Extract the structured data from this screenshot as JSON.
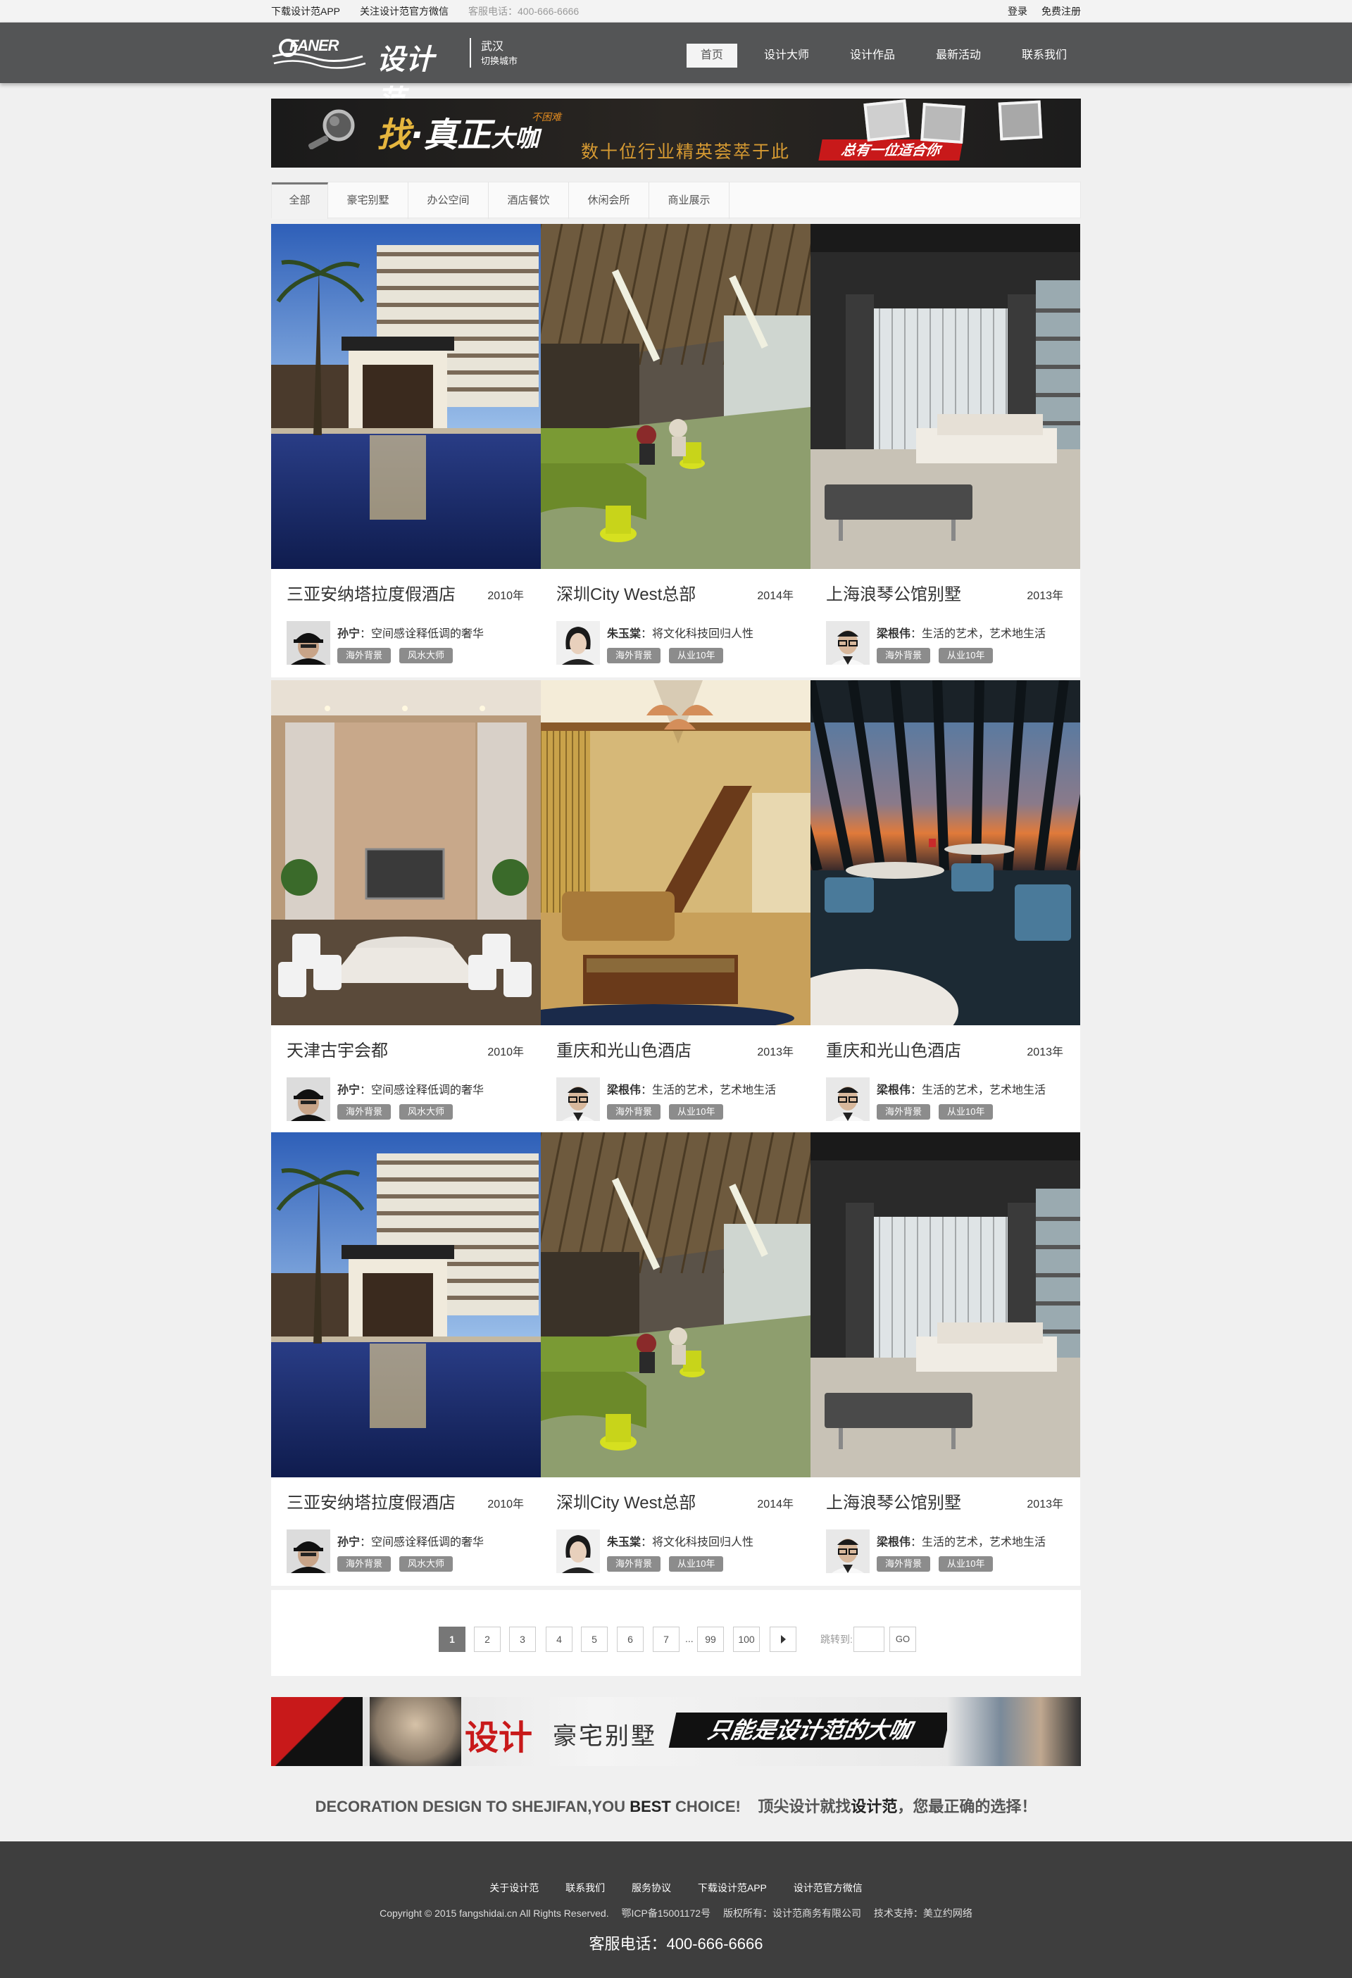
{
  "topbar": {
    "download_app": "下载设计范APP",
    "follow_wechat": "关注设计范官方微信",
    "phone": "客服电话：400-666-6666",
    "login": "登录",
    "register": "免费注册"
  },
  "header": {
    "logo_en": "FANER",
    "logo_cn": "设计范",
    "city": "武汉",
    "switch_city": "切换城市",
    "nav": [
      "首页",
      "设计大师",
      "设计作品",
      "最新活动",
      "联系我们"
    ]
  },
  "banner_top": {
    "find": "找",
    "dot": "·",
    "real": "真正",
    "not_hard": "不困难",
    "master": "大咖",
    "subtitle": "数十位行业精英荟萃于此",
    "red_tag": "总有一位适合你"
  },
  "categories": [
    "全部",
    "豪宅别墅",
    "办公空间",
    "酒店餐饮",
    "休闲会所",
    "商业展示"
  ],
  "cards": [
    {
      "title": "三亚安纳塔拉度假酒店",
      "year": "2010年",
      "designer": "孙宁",
      "motto": "：空间感诠释低调的奢华",
      "tags": [
        "海外背景",
        "风水大师"
      ],
      "scene": "hotel",
      "avatar": "cap"
    },
    {
      "title": "深圳City West总部",
      "year": "2014年",
      "designer": "朱玉棠",
      "motto": "：将文化科技回归人性",
      "tags": [
        "海外背景",
        "从业10年"
      ],
      "scene": "office",
      "avatar": "woman"
    },
    {
      "title": "上海浪琴公馆别墅",
      "year": "2013年",
      "designer": "梁根伟",
      "motto": "：生活的艺术，艺术地生活",
      "tags": [
        "海外背景",
        "从业10年"
      ],
      "scene": "living",
      "avatar": "glasses"
    },
    {
      "title": "天津古宇会都",
      "year": "2010年",
      "designer": "孙宁",
      "motto": "：空间感诠释低调的奢华",
      "tags": [
        "海外背景",
        "风水大师"
      ],
      "scene": "meeting",
      "avatar": "cap"
    },
    {
      "title": "重庆和光山色酒店",
      "year": "2013年",
      "designer": "梁根伟",
      "motto": "：生活的艺术，艺术地生活",
      "tags": [
        "海外背景",
        "从业10年"
      ],
      "scene": "classic",
      "avatar": "glasses"
    },
    {
      "title": "重庆和光山色酒店",
      "year": "2013年",
      "designer": "梁根伟",
      "motto": "：生活的艺术，艺术地生活",
      "tags": [
        "海外背景",
        "从业10年"
      ],
      "scene": "lounge",
      "avatar": "glasses"
    },
    {
      "title": "三亚安纳塔拉度假酒店",
      "year": "2010年",
      "designer": "孙宁",
      "motto": "：空间感诠释低调的奢华",
      "tags": [
        "海外背景",
        "风水大师"
      ],
      "scene": "hotel",
      "avatar": "cap"
    },
    {
      "title": "深圳City West总部",
      "year": "2014年",
      "designer": "朱玉棠",
      "motto": "：将文化科技回归人性",
      "tags": [
        "海外背景",
        "从业10年"
      ],
      "scene": "office",
      "avatar": "woman"
    },
    {
      "title": "上海浪琴公馆别墅",
      "year": "2013年",
      "designer": "梁根伟",
      "motto": "：生活的艺术，艺术地生活",
      "tags": [
        "海外背景",
        "从业10年"
      ],
      "scene": "living",
      "avatar": "glasses"
    }
  ],
  "pager": {
    "pages": [
      "1",
      "2",
      "3",
      "4",
      "5",
      "6",
      "7"
    ],
    "ellipsis": "...",
    "last_pages": [
      "99",
      "100"
    ],
    "current": "1",
    "jump_label": "跳转到:",
    "go": "GO"
  },
  "banner_bottom": {
    "design": "设计",
    "villa": "豪宅别墅",
    "tagline": "只能是设计范的大咖"
  },
  "slogan": {
    "en_a": "DECORATION DESIGN TO SHEJIFAN,YOU",
    "en_b": "BEST",
    "en_c": "CHOICE!",
    "cn_a": "顶尖设计就找",
    "cn_b": "设计范",
    "cn_c": "，您最正确的选择！"
  },
  "footer": {
    "links": [
      "关于设计范",
      "联系我们",
      "服务协议",
      "下载设计范APP",
      "设计范官方微信"
    ],
    "copyright": "Copyright © 2015 fangshidai.cn All Rights Reserved.",
    "icp": "鄂ICP备15001172号",
    "owner": "版权所有：设计范商务有限公司",
    "tech": "技术支持：美立约网络",
    "tel": "客服电话：400-666-6666"
  },
  "colors": {
    "header_bg": "#545556",
    "footer_bg": "#3e3e3e",
    "tag_bg": "#8c8c8c",
    "accent_red": "#c8191a",
    "page_bg": "#f0f0f0"
  }
}
